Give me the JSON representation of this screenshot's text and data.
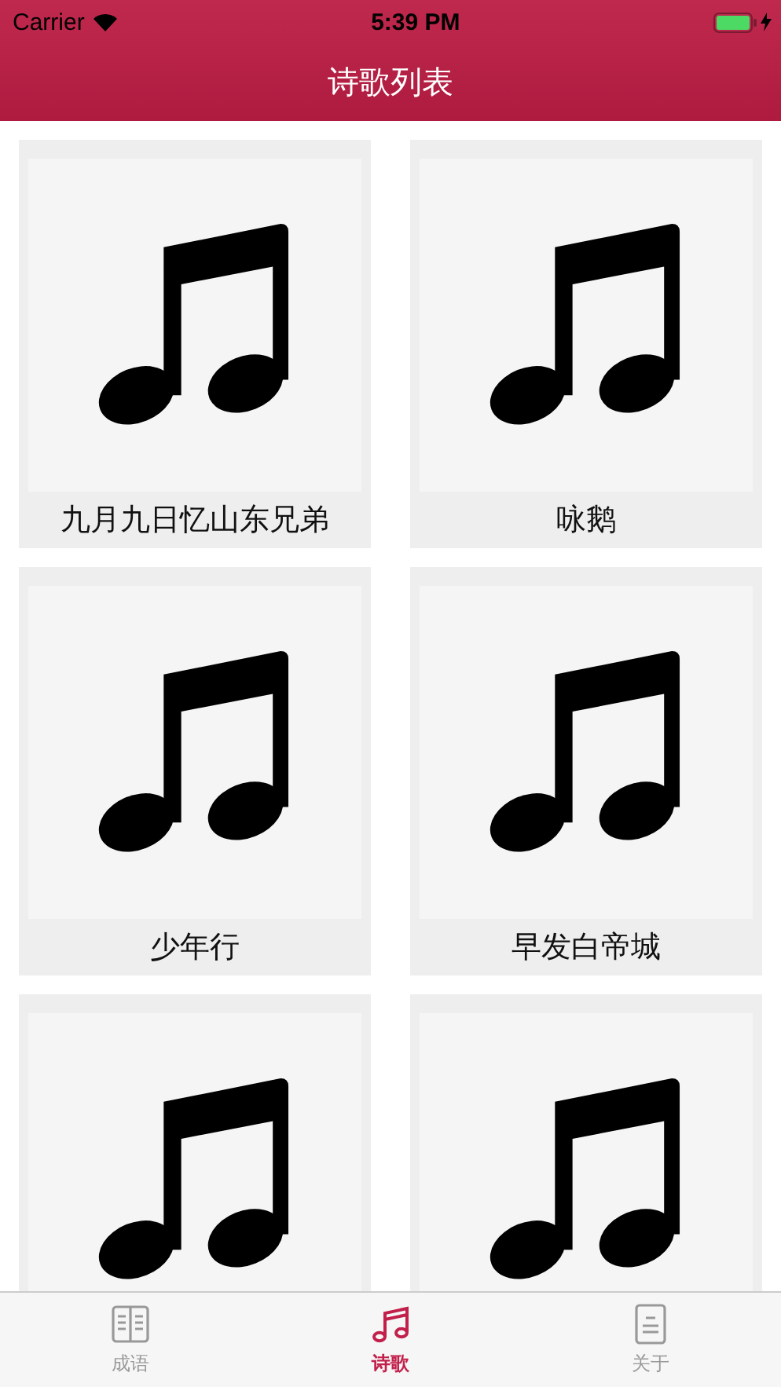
{
  "status_bar": {
    "carrier": "Carrier",
    "time": "5:39 PM"
  },
  "nav_bar": {
    "title": "诗歌列表"
  },
  "poems": [
    {
      "kind": "titled",
      "title": "九月九日忆山东兄弟"
    },
    {
      "kind": "titled",
      "title": "咏鹅"
    },
    {
      "kind": "titled",
      "title": "少年行"
    },
    {
      "kind": "titled",
      "title": "早发白帝城"
    },
    {
      "kind": "cut"
    },
    {
      "kind": "cut"
    }
  ],
  "tabs": [
    {
      "label": "成语",
      "kind": "book",
      "selected": false
    },
    {
      "label": "诗歌",
      "kind": "music",
      "selected": true
    },
    {
      "label": "关于",
      "kind": "doc",
      "selected": false
    }
  ]
}
